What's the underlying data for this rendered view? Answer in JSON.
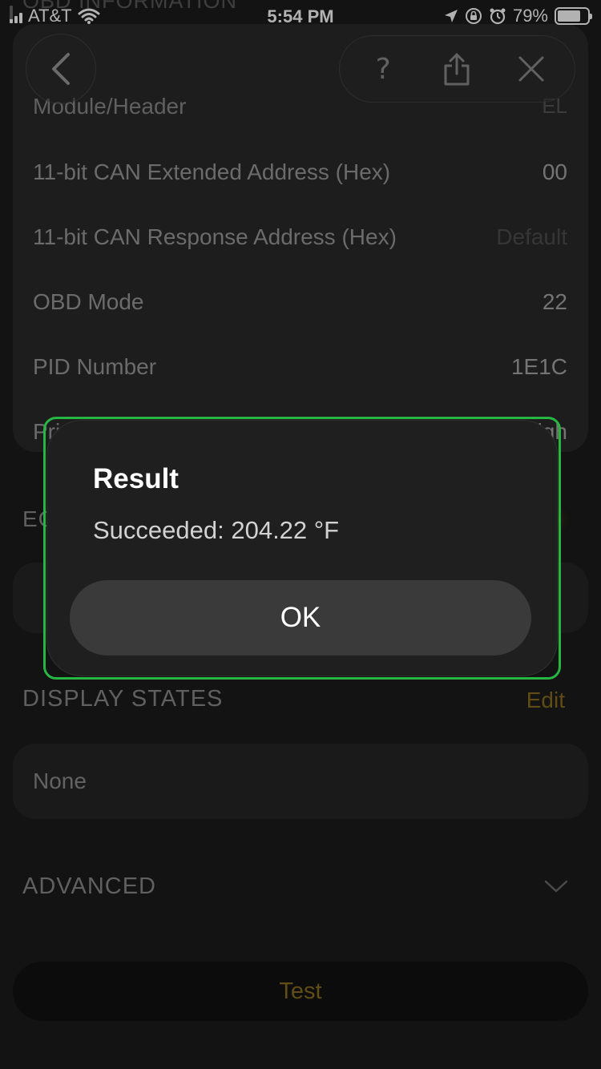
{
  "status_bar": {
    "carrier": "AT&T",
    "time": "5:54 PM",
    "battery_percent": "79%",
    "battery_level": 0.79,
    "icons": [
      "signal-icon",
      "wifi-icon",
      "location-icon",
      "orientation-lock-icon",
      "alarm-icon",
      "battery-icon"
    ]
  },
  "nav": {
    "back_icon": "chevron-left-icon",
    "help_label": "?",
    "share_icon": "share-icon",
    "close_icon": "close-icon"
  },
  "obd_section": {
    "title_peek": "OBD INFORMATION",
    "rows": [
      {
        "label": "Module/Header",
        "value": "EL"
      },
      {
        "label": "11-bit CAN Extended Address (Hex)",
        "value": "00"
      },
      {
        "label": "11-bit CAN Response Address (Hex)",
        "value": "Default"
      },
      {
        "label": "OBD Mode",
        "value": "22"
      },
      {
        "label": "PID Number",
        "value": "1E1C"
      },
      {
        "label": "Priority",
        "value": "High"
      }
    ]
  },
  "ec_section": {
    "title_peek": "EC"
  },
  "display_states": {
    "title": "DISPLAY STATES",
    "edit_label": "Edit",
    "value": "None"
  },
  "advanced": {
    "title": "ADVANCED",
    "icon": "chevron-down-icon"
  },
  "test_button": {
    "label": "Test"
  },
  "dialog": {
    "title": "Result",
    "message": "Succeeded: 204.22 °F",
    "ok_label": "OK"
  },
  "colors": {
    "accent": "#8a6d1e",
    "highlight": "#27b544",
    "card": "#2a2a2a",
    "background": "#1c1c1c"
  }
}
